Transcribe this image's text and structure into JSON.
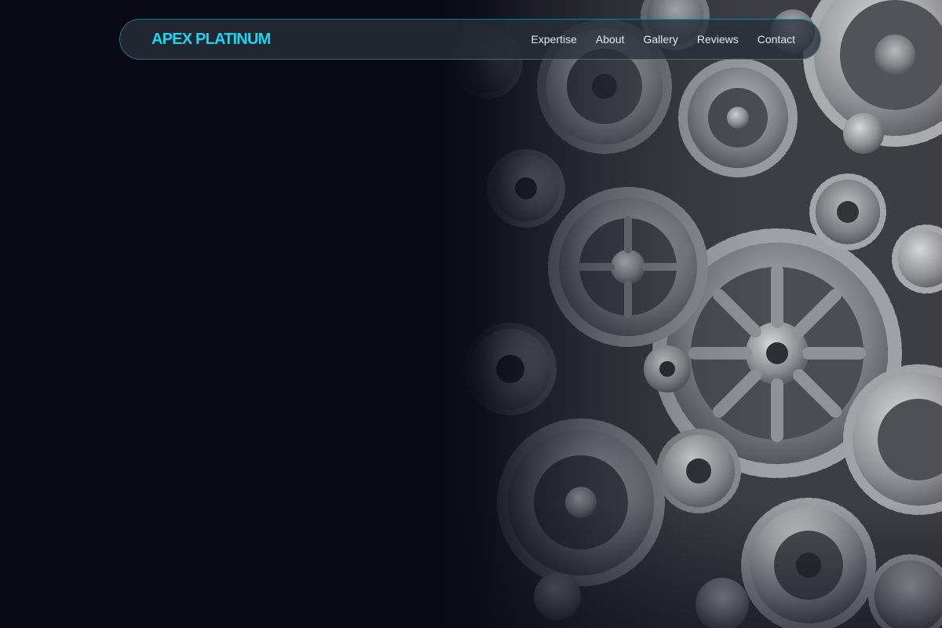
{
  "brand": {
    "logo_text": "APEX PLATINUM",
    "accent_color": "#22d3ee"
  },
  "nav": {
    "items": [
      {
        "label": "Expertise"
      },
      {
        "label": "About"
      },
      {
        "label": "Gallery"
      },
      {
        "label": "Reviews"
      },
      {
        "label": "Contact"
      }
    ]
  },
  "hero": {
    "background_color": "#080b14",
    "image_subject": "gears-image"
  }
}
